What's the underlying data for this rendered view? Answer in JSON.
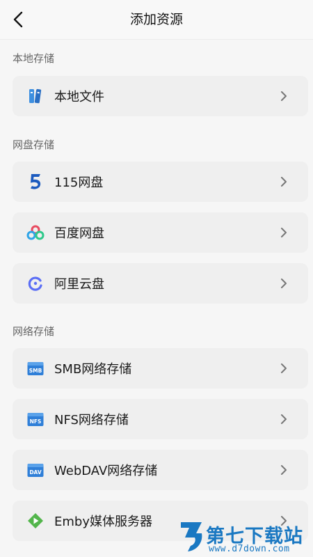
{
  "header": {
    "title": "添加资源",
    "back_icon": "back-chevron-icon"
  },
  "sections": {
    "local": "本地存储",
    "cloud": "网盘存储",
    "network": "网络存储"
  },
  "items": {
    "local_files": {
      "label": "本地文件",
      "icon": "local-files-icon"
    },
    "pan115": {
      "label": "115网盘",
      "icon": "pan-115-icon"
    },
    "baidu": {
      "label": "百度网盘",
      "icon": "baidu-pan-icon"
    },
    "aliyun": {
      "label": "阿里云盘",
      "icon": "aliyun-drive-icon"
    },
    "smb": {
      "label": "SMB网络存储",
      "icon": "smb-icon",
      "icon_text": "SMB"
    },
    "nfs": {
      "label": "NFS网络存储",
      "icon": "nfs-icon",
      "icon_text": "NFS"
    },
    "webdav": {
      "label": "WebDAV网络存储",
      "icon": "webdav-icon",
      "icon_text": "DAV"
    },
    "emby": {
      "label": "Emby媒体服务器",
      "icon": "emby-icon"
    }
  },
  "watermark": {
    "brand": "第七下载站",
    "url": "www.d7down.com"
  },
  "colors": {
    "accent": "#2f7fd8",
    "card": "#efefef",
    "background": "#f6f6f6"
  }
}
